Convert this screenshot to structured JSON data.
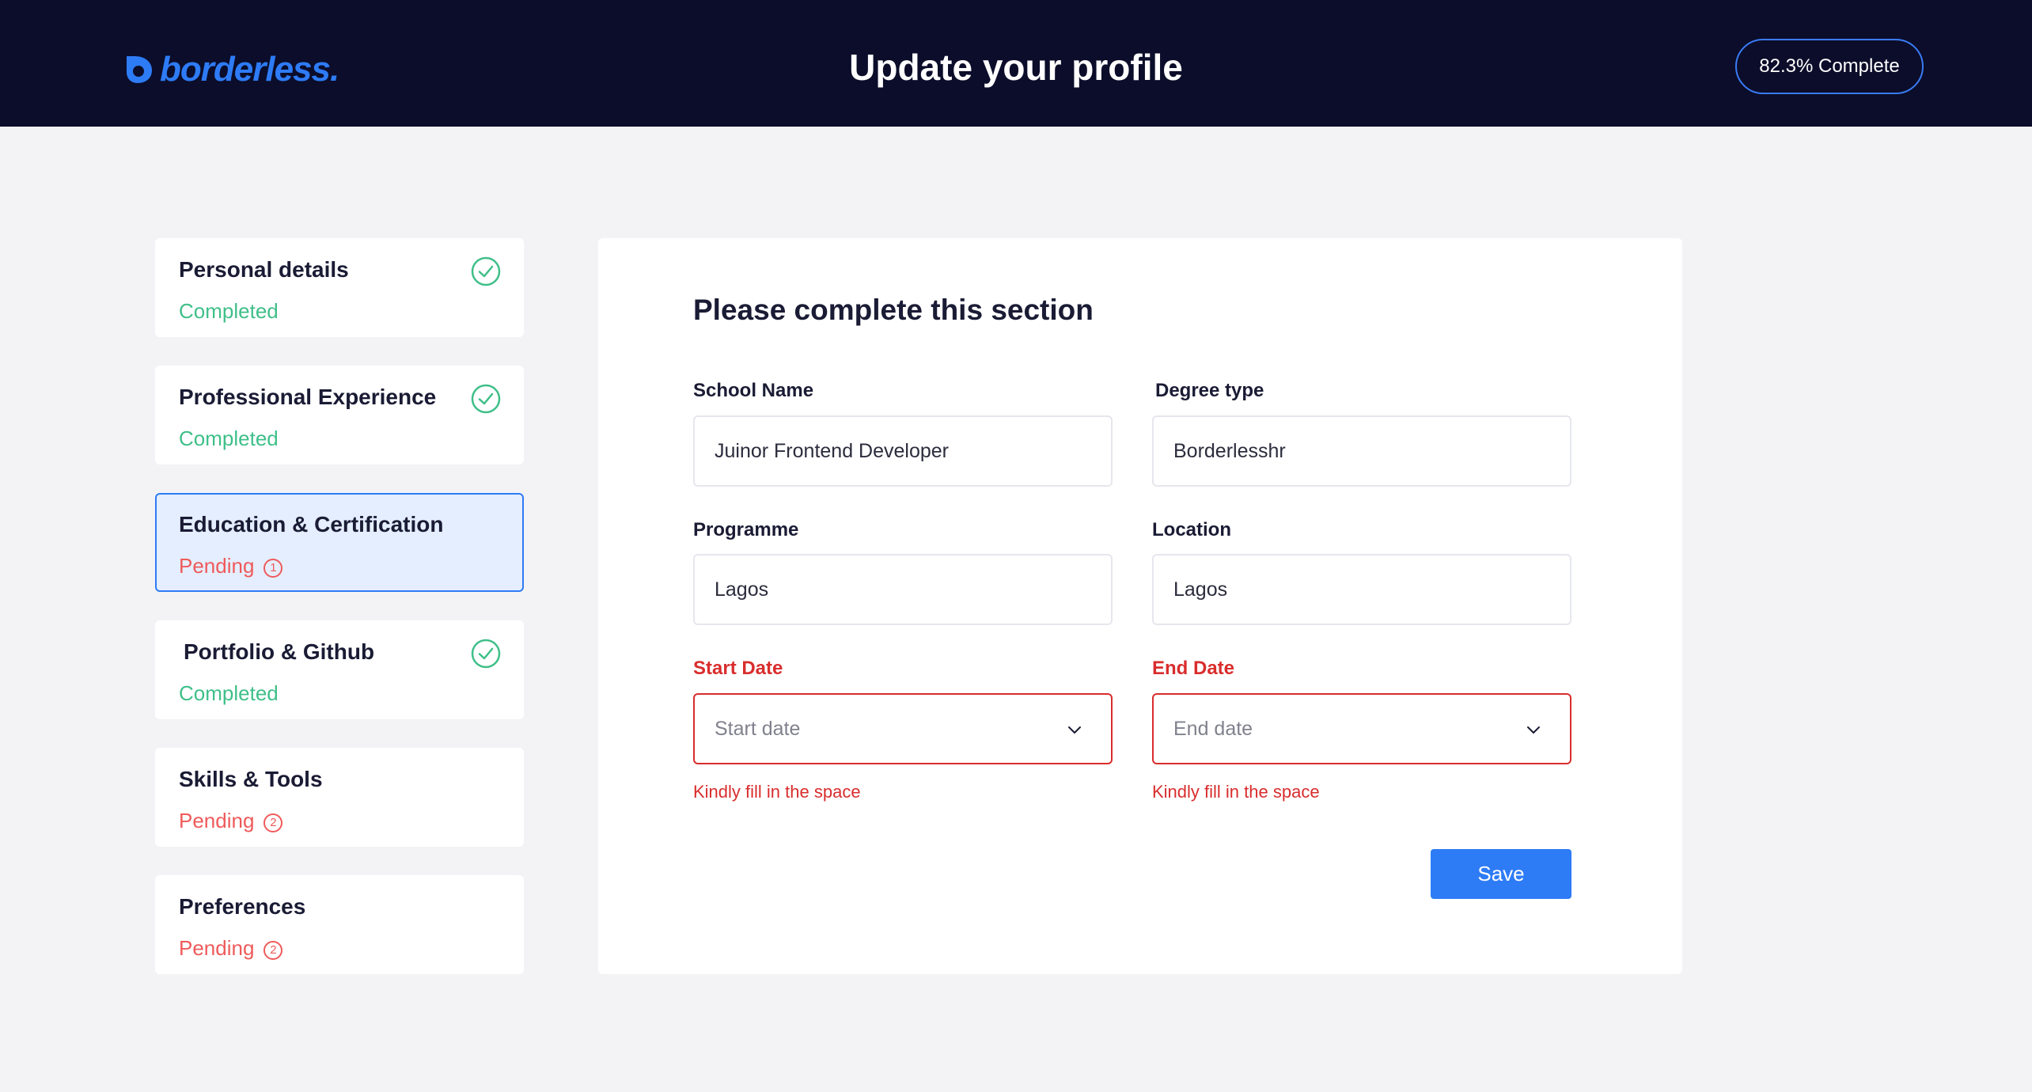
{
  "header": {
    "brand": "borderless.",
    "title": "Update your profile",
    "progress": "82.3% Complete"
  },
  "sidebar": {
    "steps": [
      {
        "title": "Personal details",
        "status": "Completed"
      },
      {
        "title": "Professional Experience",
        "status": "Completed"
      },
      {
        "title": "Education & Certification",
        "status": "Pending",
        "count": "1"
      },
      {
        "title": "Portfolio & Github",
        "status": "Completed"
      },
      {
        "title": "Skills & Tools",
        "status": "Pending",
        "count": "2"
      },
      {
        "title": "Preferences",
        "status": "Pending",
        "count": "2"
      }
    ]
  },
  "form": {
    "title": "Please complete this section",
    "school_name": {
      "label": "School Name",
      "value": "Juinor Frontend Developer"
    },
    "degree_type": {
      "label": "Degree type",
      "value": "Borderlesshr"
    },
    "programme": {
      "label": "Programme",
      "value": "Lagos"
    },
    "location": {
      "label": "Location",
      "value": "Lagos"
    },
    "start_date": {
      "label": "Start Date",
      "placeholder": "Start date",
      "error": "Kindly fill in the space"
    },
    "end_date": {
      "label": "End Date",
      "placeholder": "End date",
      "error": "Kindly fill in the space"
    },
    "save_label": "Save"
  },
  "colors": {
    "header_bg": "#0b0d2a",
    "brand_blue": "#2e7bf6",
    "completed_green": "#3fbf89",
    "pending_red": "#ef5a5a",
    "error_red": "#d92d2d"
  },
  "icons": {
    "logo": "borderless-logo-icon",
    "check": "check-circle-icon",
    "chevron": "chevron-down-icon"
  }
}
